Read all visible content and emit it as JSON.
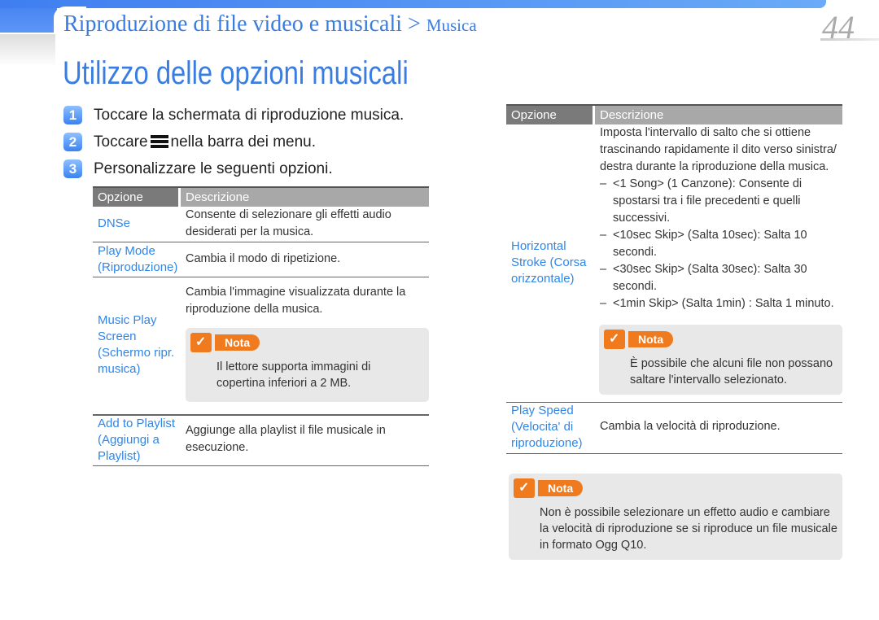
{
  "header": {
    "breadcrumb_section": "Riproduzione di file video e musicali",
    "breadcrumb_sep": ">",
    "breadcrumb_page": "Musica",
    "page_number": "44"
  },
  "title": "Utilizzo delle opzioni musicali",
  "steps": [
    {
      "num": "1",
      "text": "Toccare la schermata di riproduzione musica."
    },
    {
      "num": "2",
      "text_before": "Toccare",
      "icon": "menu-icon",
      "text_after": "nella barra dei menu."
    },
    {
      "num": "3",
      "text": "Personalizzare le seguenti opzioni."
    }
  ],
  "table_headers": {
    "option": "Opzione",
    "description": "Descrizione"
  },
  "left_table": [
    {
      "option": "DNSe",
      "description": "Consente di selezionare gli effetti audio desiderati per la musica."
    },
    {
      "option": "Play Mode (Riproduzione)",
      "description": "Cambia il modo di ripetizione."
    },
    {
      "option": "Music Play Screen (Schermo ripr. musica)",
      "description": "Cambia l'immagine visualizzata durante la riproduzione della musica.",
      "note_label": "Nota",
      "note": "Il lettore supporta immagini di copertina inferiori a 2 MB."
    },
    {
      "option": "Add to Playlist (Aggiungi a Playlist)",
      "description": "Aggiunge alla playlist il file musicale in esecuzione."
    }
  ],
  "right_table": [
    {
      "option": "Horizontal Stroke (Corsa orizzontale)",
      "description": "Imposta l'intervallo di salto che si ottiene trascinando rapidamente il dito verso sinistra/ destra durante la riproduzione della musica.",
      "items": [
        "<1 Song> (1 Canzone): Consente di spostarsi tra i file precedenti e quelli successivi.",
        "<10sec Skip> (Salta 10sec): Salta 10 secondi.",
        "<30sec Skip> (Salta 30sec): Salta 30 secondi.",
        "<1min Skip> (Salta 1min) : Salta 1 minuto."
      ],
      "note_label": "Nota",
      "note": "È possibile che alcuni file non possano saltare l'intervallo selezionato."
    },
    {
      "option": "Play Speed (Velocita' di riproduzione)",
      "description": "Cambia la velocità di riproduzione."
    }
  ],
  "bottom_note": {
    "label": "Nota",
    "text": "Non è possibile selezionare un effetto audio e cambiare la velocità di riproduzione se si riproduce un file musicale in formato Ogg Q10."
  },
  "colors": {
    "accent": "#3a7de0",
    "link": "#2f86e8",
    "note_orange": "#f07a1e",
    "note_bg": "#e8e8e8"
  }
}
